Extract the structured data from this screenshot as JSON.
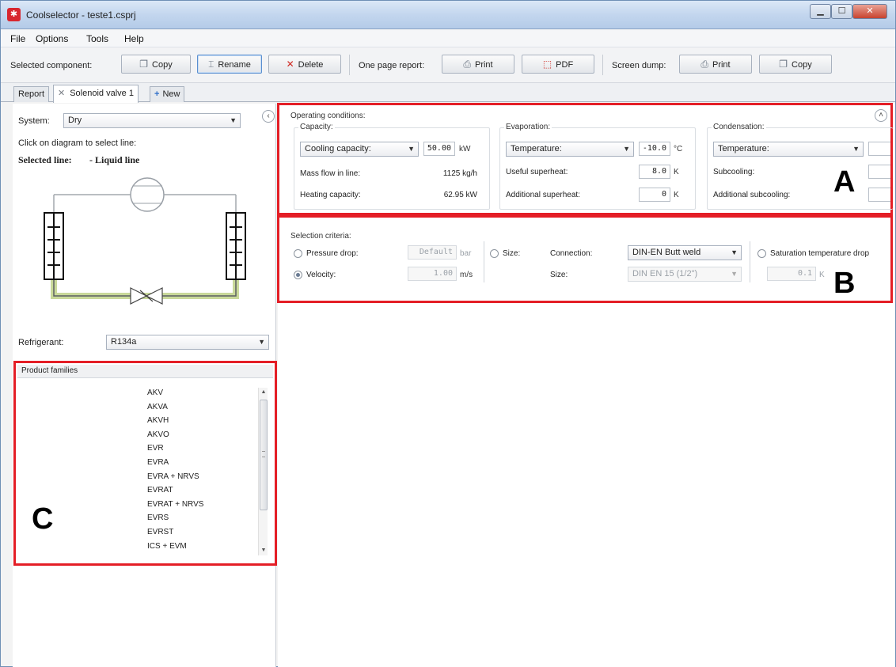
{
  "window": {
    "title": "Coolselector - teste1.csprj",
    "app_icon": "snowflake-icon"
  },
  "menu": [
    "File",
    "Options",
    "Tools",
    "Help"
  ],
  "toolbar": {
    "selected_component_label": "Selected component:",
    "copy": "Copy",
    "rename": "Rename",
    "delete": "Delete",
    "one_page_report_label": "One page report:",
    "print": "Print",
    "pdf": "PDF",
    "screen_dump_label": "Screen dump:",
    "print2": "Print",
    "copy2": "Copy"
  },
  "tabs": {
    "report": "Report",
    "active": "Solenoid valve 1",
    "new": "New"
  },
  "left": {
    "system_label": "System:",
    "system_value": "Dry",
    "instruction": "Click on diagram to select line:",
    "selected_line_label": "Selected line:",
    "selected_line_value": "- Liquid line",
    "refrigerant_label": "Refrigerant:",
    "refrigerant_value": "R134a"
  },
  "product_families": {
    "title": "Product families",
    "items": [
      "AKV",
      "AKVA",
      "AKVH",
      "AKVO",
      "EVR",
      "EVRA",
      "EVRA + NRVS",
      "EVRAT",
      "EVRAT + NRVS",
      "EVRS",
      "EVRST",
      "ICS + EVM"
    ]
  },
  "operating": {
    "title": "Operating conditions:",
    "capacity": {
      "title": "Capacity:",
      "type": "Cooling capacity:",
      "value": "50.00",
      "unit": "kW",
      "mass_flow_label": "Mass flow in line:",
      "mass_flow_value": "1125 kg/h",
      "heating_label": "Heating capacity:",
      "heating_value": "62.95 kW"
    },
    "evaporation": {
      "title": "Evaporation:",
      "type": "Temperature:",
      "value": "-10.0",
      "unit": "°C",
      "useful_label": "Useful superheat:",
      "useful_value": "8.0",
      "useful_unit": "K",
      "additional_label": "Additional superheat:",
      "additional_value": "0",
      "additional_unit": "K"
    },
    "condensation": {
      "title": "Condensation:",
      "type": "Temperature:",
      "subcooling_label": "Subcooling:",
      "additional_label": "Additional subcooling:"
    }
  },
  "selection": {
    "title": "Selection criteria:",
    "pressure_drop_label": "Pressure drop:",
    "pressure_drop_value": "Default",
    "pressure_drop_unit": "bar",
    "velocity_label": "Velocity:",
    "velocity_value": "1.00",
    "velocity_unit": "m/s",
    "size_radio_label": "Size:",
    "connection_label": "Connection:",
    "connection_value": "DIN-EN Butt weld",
    "size_label": "Size:",
    "size_value": "DIN EN 15 (1/2\")",
    "saturation_label": "Saturation temperature drop",
    "saturation_value": "0.1",
    "saturation_unit": "K"
  },
  "letters": {
    "a": "A",
    "b": "B",
    "c": "C"
  }
}
